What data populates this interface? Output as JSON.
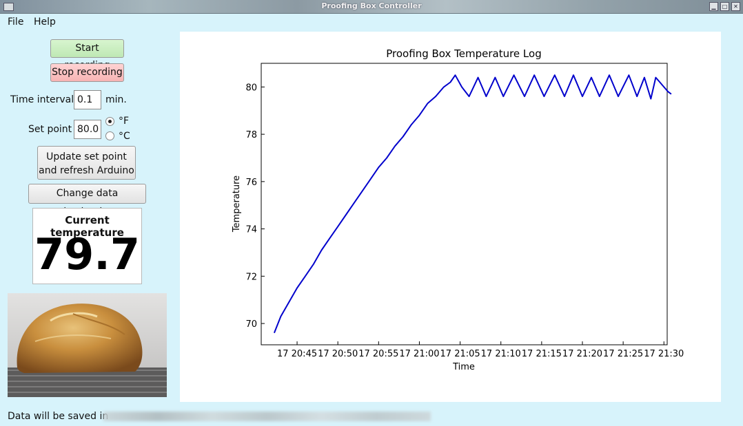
{
  "window": {
    "title": "Proofing Box Controller"
  },
  "menu": {
    "file": "File",
    "help": "Help"
  },
  "controls": {
    "start_label": "Start recording",
    "stop_label": "Stop recording",
    "interval_label": "Time interval",
    "interval_value": "0.1",
    "interval_unit": "min.",
    "setpoint_label": "Set point",
    "setpoint_value": "80.0",
    "unit_f": "°F",
    "unit_c": "°C",
    "selected_unit": "F",
    "update_line1": "Update set point",
    "update_line2": "and refresh Arduino",
    "change_dest_label": "Change data destination"
  },
  "current": {
    "heading": "Current temperature",
    "value": "79.7"
  },
  "status": {
    "text": "Data will be saved in"
  },
  "chart_data": {
    "type": "line",
    "title": "Proofing Box Temperature Log",
    "xlabel": "Time",
    "ylabel": "Temperature",
    "xticks": [
      "17 20:45",
      "17 20:50",
      "17 20:55",
      "17 21:00",
      "17 21:05",
      "17 21:10",
      "17 21:15",
      "17 21:20",
      "17 21:25",
      "17 21:30"
    ],
    "yticks": [
      70,
      72,
      74,
      76,
      78,
      80
    ],
    "xlim_minutes_after_2040": [
      0.6,
      50.4
    ],
    "ylim": [
      69.1,
      81.0
    ],
    "series": [
      {
        "color": "#0000cc",
        "points": [
          [
            2.2,
            69.6
          ],
          [
            3.0,
            70.3
          ],
          [
            4.0,
            70.9
          ],
          [
            5.0,
            71.5
          ],
          [
            6.0,
            72.0
          ],
          [
            7.0,
            72.5
          ],
          [
            8.0,
            73.1
          ],
          [
            9.0,
            73.6
          ],
          [
            10.0,
            74.1
          ],
          [
            11.0,
            74.6
          ],
          [
            12.0,
            75.1
          ],
          [
            13.0,
            75.6
          ],
          [
            14.0,
            76.1
          ],
          [
            15.0,
            76.6
          ],
          [
            16.0,
            77.0
          ],
          [
            17.0,
            77.5
          ],
          [
            18.0,
            77.9
          ],
          [
            19.0,
            78.4
          ],
          [
            20.0,
            78.8
          ],
          [
            21.0,
            79.3
          ],
          [
            22.0,
            79.6
          ],
          [
            23.0,
            80.0
          ],
          [
            23.8,
            80.2
          ],
          [
            24.4,
            80.5
          ],
          [
            25.2,
            80.0
          ],
          [
            26.1,
            79.6
          ],
          [
            27.2,
            80.4
          ],
          [
            28.2,
            79.6
          ],
          [
            29.3,
            80.4
          ],
          [
            30.3,
            79.6
          ],
          [
            31.6,
            80.5
          ],
          [
            32.9,
            79.6
          ],
          [
            34.1,
            80.5
          ],
          [
            35.3,
            79.6
          ],
          [
            36.6,
            80.5
          ],
          [
            37.8,
            79.6
          ],
          [
            38.9,
            80.5
          ],
          [
            40.0,
            79.6
          ],
          [
            41.1,
            80.4
          ],
          [
            42.1,
            79.6
          ],
          [
            43.3,
            80.5
          ],
          [
            44.4,
            79.6
          ],
          [
            45.7,
            80.5
          ],
          [
            46.7,
            79.6
          ],
          [
            47.6,
            80.4
          ],
          [
            48.4,
            79.5
          ],
          [
            49.0,
            80.4
          ],
          [
            49.5,
            80.2
          ],
          [
            50.0,
            80.0
          ],
          [
            50.5,
            79.8
          ],
          [
            50.9,
            79.7
          ]
        ]
      }
    ]
  }
}
